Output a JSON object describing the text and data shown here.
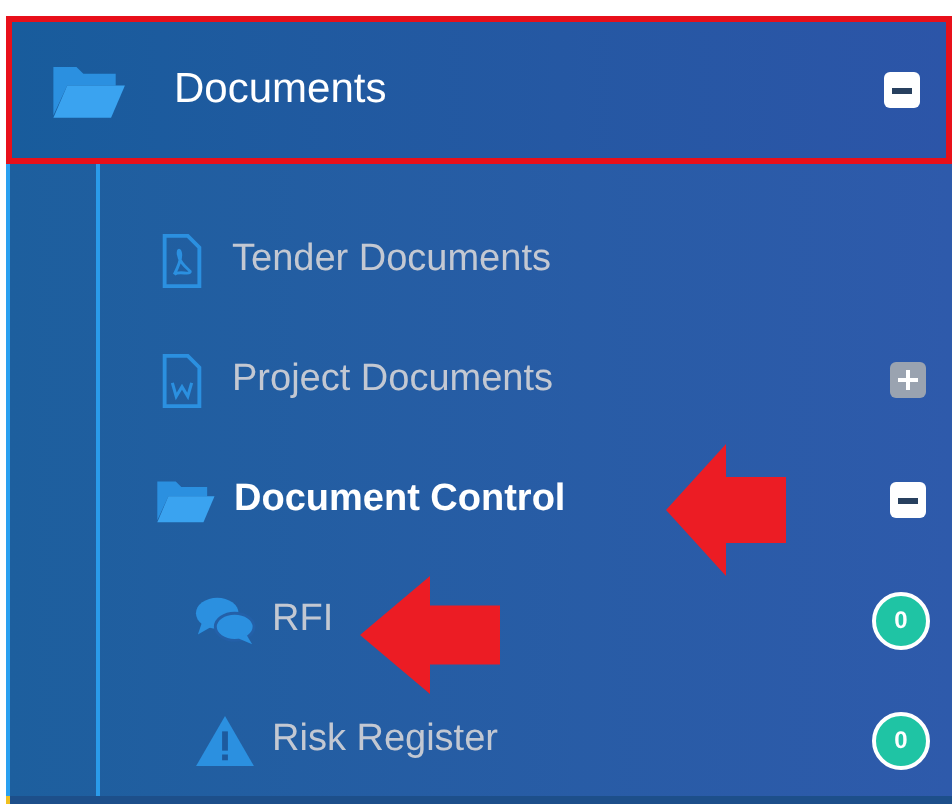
{
  "menu": {
    "label": "Documents",
    "kind": "folder",
    "expanded": true,
    "highlighted": true,
    "children": [
      {
        "label": "Tender Documents",
        "kind": "pdf",
        "selected": false
      },
      {
        "label": "Project Documents",
        "kind": "word",
        "expanded": false,
        "selected": false
      },
      {
        "label": "Document Control",
        "kind": "folder",
        "expanded": true,
        "selected": true,
        "arrow": true,
        "children": [
          {
            "label": "RFI",
            "kind": "chat",
            "badge": "0",
            "arrow": true,
            "selected": false
          },
          {
            "label": "Risk Register",
            "kind": "warning",
            "badge": "0",
            "selected": false
          }
        ]
      }
    ]
  }
}
